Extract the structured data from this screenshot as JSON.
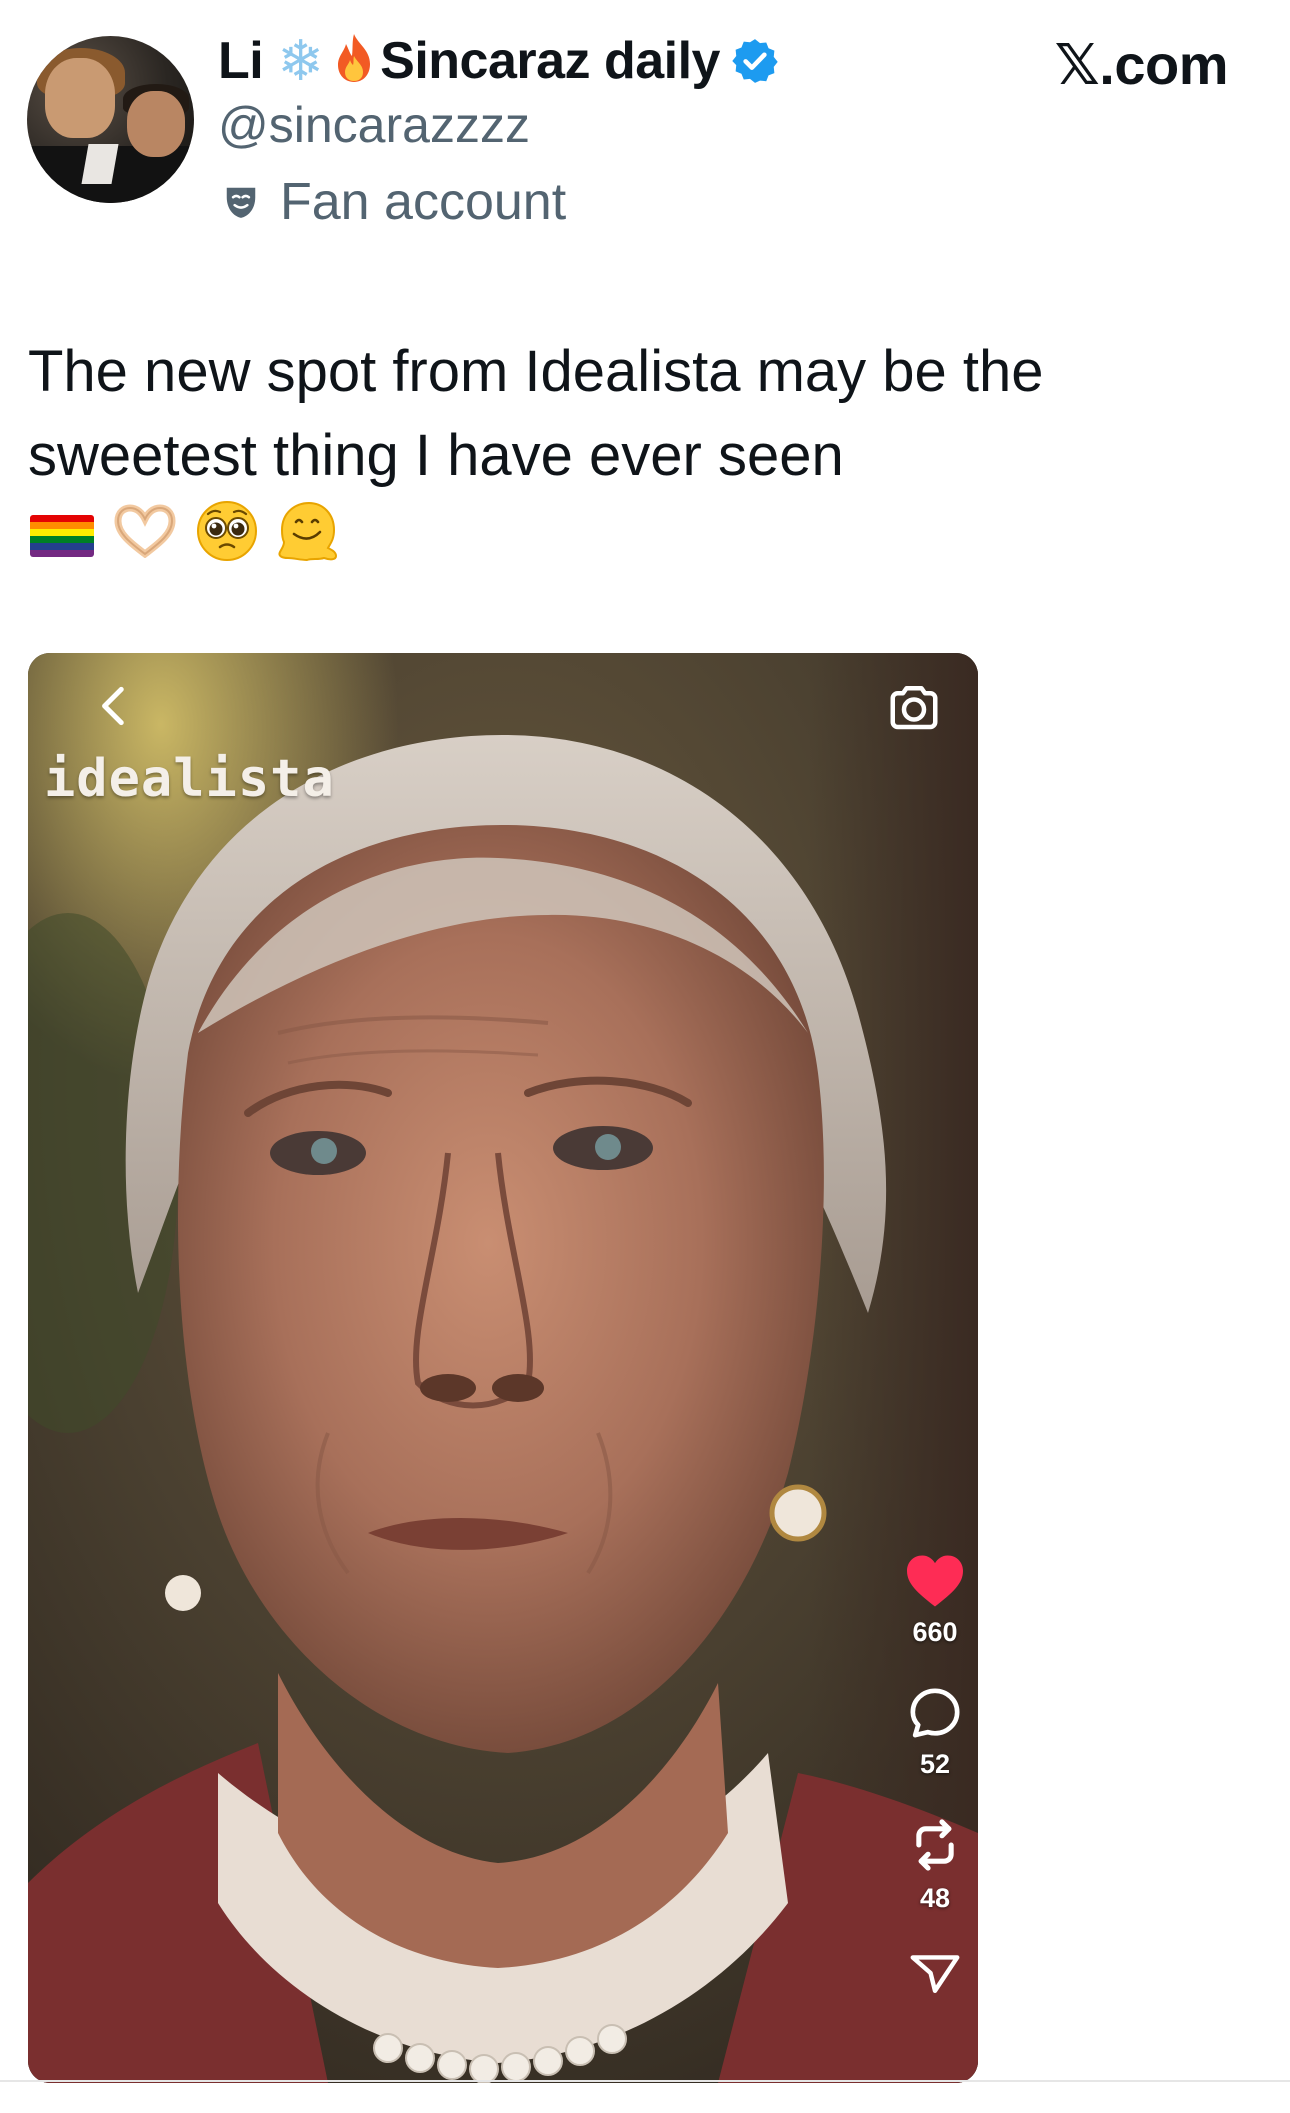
{
  "header": {
    "name_prefix": "Li",
    "name_suffix": "Sincaraz daily",
    "emoji_1": "snowflake",
    "emoji_2": "fire",
    "verified": true,
    "handle": "@sincarazzzz",
    "label": "Fan account",
    "brand": "𝕏.com"
  },
  "tweet": {
    "text": "The new spot from Idealista may be the sweetest thing I have ever seen",
    "emojis": [
      "rainbow-flag",
      "heart-hands",
      "pleading-face",
      "melting-face"
    ]
  },
  "media": {
    "logo_text": "idealista",
    "actions": {
      "likes": "660",
      "comments": "52",
      "reposts": "48"
    }
  },
  "colors": {
    "text": "#0f1419",
    "secondary": "#536471",
    "verified": "#1d9bf0",
    "like": "#fe2c55"
  }
}
